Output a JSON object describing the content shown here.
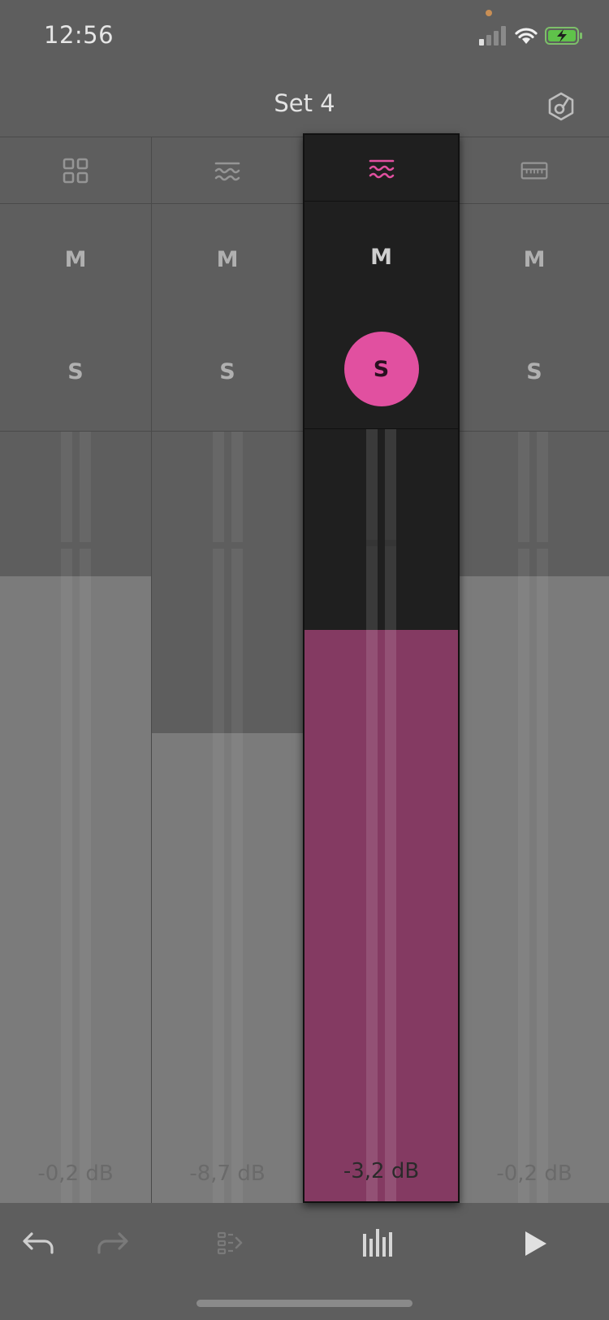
{
  "status_bar": {
    "time": "12:56",
    "signal_icon": "cellular-signal-icon",
    "wifi_icon": "wifi-icon",
    "battery_icon": "battery-charging-icon"
  },
  "header": {
    "title": "Set 4",
    "right_icon": "tuner-icon"
  },
  "colors": {
    "accent": "#e150a0",
    "selected_fill": "#843a62",
    "fader_fill": "#7b7b7b"
  },
  "channels": [
    {
      "type_icon": "grid-icon",
      "mute_label": "M",
      "solo_label": "S",
      "solo_active": false,
      "level": "-0,2 dB",
      "fader_fraction": 0.813
    },
    {
      "type_icon": "waves-icon",
      "mute_label": "M",
      "solo_label": "S",
      "solo_active": false,
      "level": "-8,7 dB",
      "fader_fraction": 0.609
    },
    {
      "type_icon": "waves-icon",
      "mute_label": "M",
      "solo_label": "S",
      "solo_active": true,
      "selected": true,
      "level": "-3,2 dB",
      "fader_fraction": 0.74
    },
    {
      "type_icon": "keyboard-icon",
      "mute_label": "M",
      "solo_label": "S",
      "solo_active": false,
      "level": "-0,2 dB",
      "fader_fraction": 0.813
    }
  ],
  "bottom_bar": {
    "undo_icon": "undo-icon",
    "redo_icon": "redo-icon",
    "clip_view_icon": "clip-view-icon",
    "mixer_icon": "mixer-icon",
    "play_icon": "play-icon"
  }
}
